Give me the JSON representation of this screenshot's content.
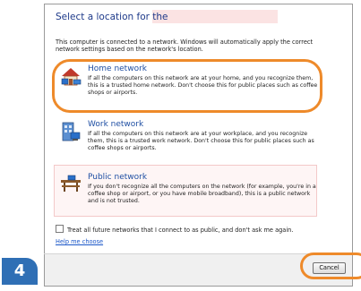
{
  "dialog": {
    "title": "Select a location for the",
    "intro": "This computer is connected to a network. Windows will automatically apply the correct network settings based on the network's location."
  },
  "options": [
    {
      "title": "Home network",
      "description": "If all the computers on this network are at your home, and you recognize them, this is a trusted home network.  Don't choose this for public places such as coffee shops or airports.",
      "icon": "home-network-icon"
    },
    {
      "title": "Work network",
      "description": "If all the computers on this network are at your workplace, and you recognize them, this is a trusted work network. Don't choose this for public places such as coffee shops or airports.",
      "icon": "work-network-icon"
    },
    {
      "title": "Public network",
      "description": "If you don't recognize all the computers on the network (for example, you're in a coffee shop or airport, or you have mobile broadband), this is a public network and is not trusted.",
      "icon": "public-network-icon"
    }
  ],
  "treat_public_label": "Treat all future networks that I connect to as public, and don't ask me again.",
  "help_link": "Help me choose",
  "cancel_label": "Cancel",
  "step_number": "4",
  "colors": {
    "highlight": "#ee8a2a",
    "title_blue": "#1e3a8a",
    "badge_blue": "#2f6fb5"
  }
}
